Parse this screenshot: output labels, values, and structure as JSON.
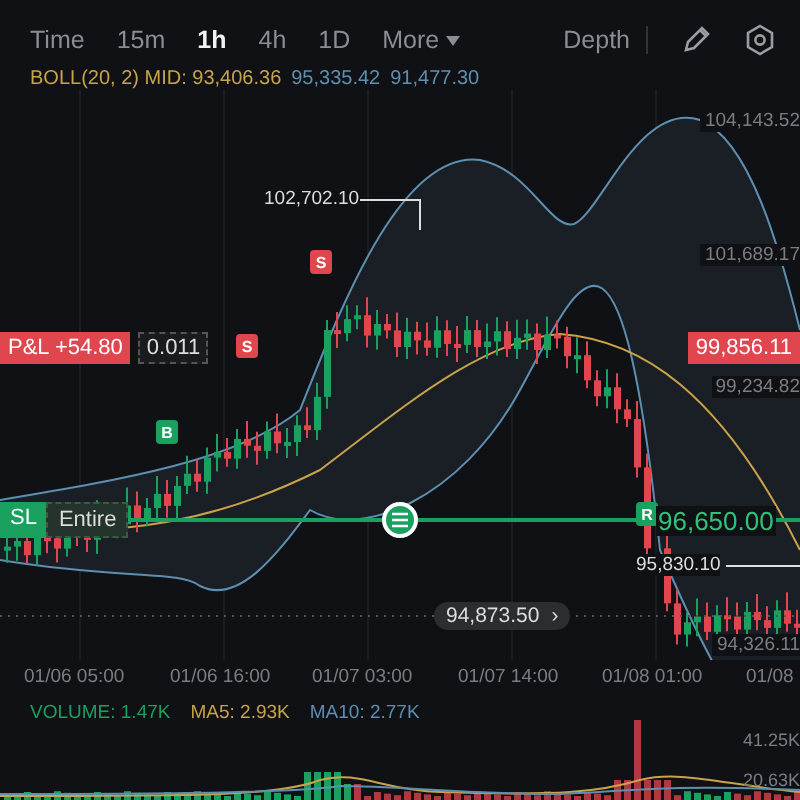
{
  "tabs": [
    {
      "label": "Time",
      "selected": false
    },
    {
      "label": "15m",
      "selected": false
    },
    {
      "label": "1h",
      "selected": true
    },
    {
      "label": "4h",
      "selected": false
    },
    {
      "label": "1D",
      "selected": false
    },
    {
      "label": "More",
      "selected": false
    }
  ],
  "depth_tab": "Depth",
  "boll": {
    "label": "BOLL(20, 2) MID: 93,406.36",
    "upper": "95,335.42",
    "lower": "91,477.30"
  },
  "price_axis": [
    "104,143.52",
    "101,689.17",
    "99,234.82",
    "94,326.11"
  ],
  "high_label": "102,702.10",
  "low_label": "95,830.10",
  "markers": [
    {
      "kind": "sell",
      "text": "S"
    },
    {
      "kind": "sell",
      "text": "S"
    },
    {
      "kind": "buy",
      "text": "B"
    },
    {
      "kind": "tp",
      "text": "R"
    }
  ],
  "position": {
    "pnl": "P&L +54.80",
    "qty": "0.011"
  },
  "last_price": "99,856.11",
  "stop_loss": {
    "label": "SL",
    "scope": "Entire",
    "price": "96,650.00"
  },
  "current_price": {
    "value": "94,873.50",
    "arrow": "›"
  },
  "time_axis": [
    "01/06 05:00",
    "01/06 16:00",
    "01/07 03:00",
    "01/07 14:00",
    "01/08 01:00",
    "01/08"
  ],
  "volume": {
    "volume": "VOLUME: 1.47K",
    "ma5": "MA5: 2.93K",
    "ma10": "MA10: 2.77K",
    "axis": [
      "41.25K",
      "20.63K"
    ]
  }
}
